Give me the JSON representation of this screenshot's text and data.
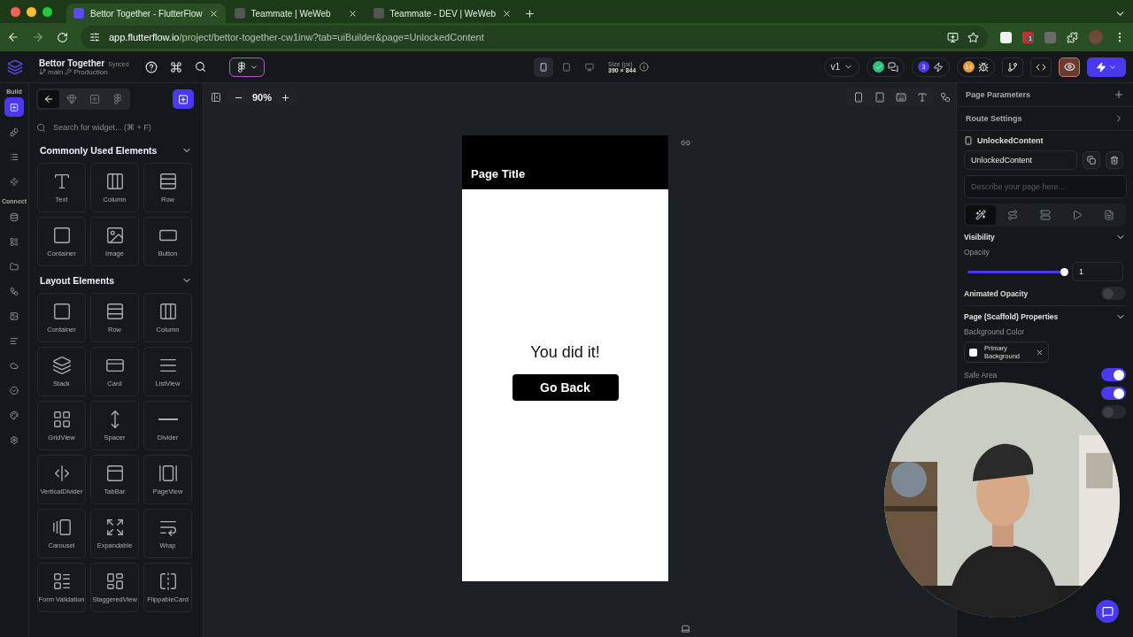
{
  "browser": {
    "tabs": [
      {
        "title": "Bettor Together - FlutterFlow",
        "selected": true
      },
      {
        "title": "Teammate | WeWeb",
        "selected": false
      },
      {
        "title": "Teammate - DEV | WeWeb",
        "selected": false
      }
    ],
    "url": {
      "host": "app.flutterflow.io",
      "path": "/project/bettor-together-cw1inw?tab=uiBuilder&page=UnlockedContent"
    },
    "extension_badge": "1"
  },
  "header": {
    "project": "Bettor Together",
    "sync_status": "Synced",
    "branch": "main",
    "environment": "Production",
    "devices": [
      {
        "kind": "phone",
        "selected": true
      },
      {
        "kind": "tablet",
        "selected": false
      },
      {
        "kind": "desktop",
        "selected": false
      }
    ],
    "size_label": "Size (px)",
    "size_value": "390 × 844",
    "version": "v1",
    "task_count": "3",
    "issue_count": "14",
    "preview_on": true
  },
  "rail": {
    "sections": [
      {
        "title": "Build",
        "items": [
          {
            "selected": true
          },
          {
            "selected": false
          },
          {
            "selected": false
          },
          {
            "selected": false
          }
        ]
      },
      {
        "title": "Connect",
        "items": [
          {
            "selected": false
          },
          {
            "selected": false
          },
          {
            "selected": false
          },
          {
            "selected": false
          },
          {
            "selected": false
          },
          {
            "selected": false
          },
          {
            "selected": false
          },
          {
            "selected": false
          },
          {
            "selected": false
          },
          {
            "selected": false
          }
        ]
      }
    ]
  },
  "widget_panel": {
    "tabs": [
      {
        "selected": true
      },
      {
        "selected": false
      },
      {
        "selected": false
      },
      {
        "selected": false
      }
    ],
    "search_placeholder": "Search for widget... (⌘ + F)",
    "groups": [
      {
        "title": "Commonly Used Elements",
        "expanded": true,
        "items": [
          "Text",
          "Column",
          "Row",
          "Container",
          "Image",
          "Button"
        ]
      },
      {
        "title": "Layout Elements",
        "expanded": true,
        "items": [
          "Container",
          "Row",
          "Column",
          "Stack",
          "Card",
          "ListView",
          "GridView",
          "Spacer",
          "Divider",
          "VerticalDivider",
          "TabBar",
          "PageView",
          "Carousel",
          "Expandable",
          "Wrap",
          "Form Validation",
          "StaggeredView",
          "FlippableCard"
        ]
      }
    ]
  },
  "canvas": {
    "zoom": "90%",
    "phone": {
      "title": "Page Title",
      "message": "You did it!",
      "button": "Go Back"
    }
  },
  "properties": {
    "page_parameters": "Page Parameters",
    "route_settings": "Route Settings",
    "page_name": "UnlockedContent",
    "name_value": "UnlockedContent",
    "description_placeholder": "Describe your page here...",
    "tabs": [
      {
        "selected": true
      },
      {
        "selected": false
      },
      {
        "selected": false
      },
      {
        "selected": false
      },
      {
        "selected": false
      }
    ],
    "visibility": {
      "title": "Visibility",
      "expanded": true,
      "opacity_label": "Opacity",
      "level": 1,
      "opacity_value": "1",
      "animated_label": "Animated Opacity",
      "animated_on": false
    },
    "scaffold": {
      "title": "Page (Scaffold) Properties",
      "expanded": true,
      "background_label": "Background Color",
      "background_value": "Primary Background",
      "safe_area_label": "Safe Area",
      "toggles": [
        {
          "on": true
        },
        {
          "on": true
        },
        {
          "on": false
        }
      ]
    }
  }
}
